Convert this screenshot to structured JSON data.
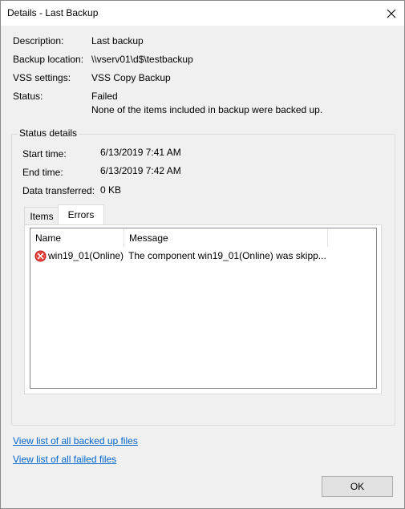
{
  "window": {
    "title": "Details - Last Backup"
  },
  "summary": {
    "description_label": "Description:",
    "description_value": "Last backup",
    "location_label": "Backup location:",
    "location_value": "\\\\vserv01\\d$\\testbackup",
    "vss_label": "VSS settings:",
    "vss_value": "VSS Copy Backup",
    "status_label": "Status:",
    "status_value": "Failed",
    "status_message": "None of the items included in backup were backed up."
  },
  "status_details": {
    "title": "Status details",
    "start_label": "Start time:",
    "start_value": "6/13/2019 7:41 AM",
    "end_label": "End time:",
    "end_value": "6/13/2019 7:42 AM",
    "data_label": "Data transferred:",
    "data_value": "0 KB"
  },
  "tabs": [
    {
      "label": "Items",
      "active": false
    },
    {
      "label": "Errors",
      "active": true
    }
  ],
  "errors_table": {
    "columns": [
      "Name",
      "Message"
    ],
    "rows": [
      {
        "icon": "error-icon",
        "name": "win19_01(Online)",
        "message": "The component win19_01(Online) was skipp..."
      }
    ]
  },
  "links": {
    "backed_up": "View list of all backed up files",
    "failed": "View list of all failed files"
  },
  "buttons": {
    "ok": "OK"
  },
  "colors": {
    "link": "#0066cc",
    "error": "#d32f2f"
  }
}
